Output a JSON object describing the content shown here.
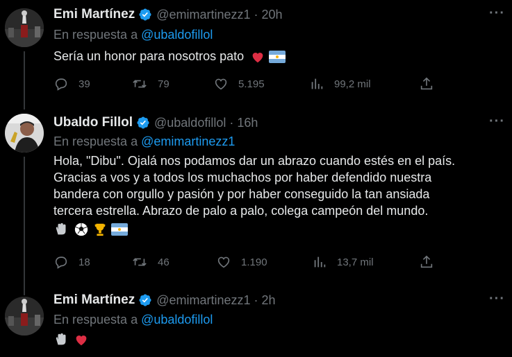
{
  "tweets": [
    {
      "name": "Emi Martínez",
      "handle": "@emimartinezz1",
      "time": "20h",
      "reply_prefix": "En respuesta a",
      "reply_mention": "@ubaldofillol",
      "text": "Sería un honor para nosotros pato",
      "emojis": [
        "red-heart",
        "argentina-flag"
      ],
      "replies": "39",
      "retweets": "79",
      "likes": "5.195",
      "views": "99,2 mil"
    },
    {
      "name": "Ubaldo Fillol",
      "handle": "@ubaldofillol",
      "time": "16h",
      "reply_prefix": "En respuesta a",
      "reply_mention": "@emimartinezz1",
      "text_lines": [
        "Hola, \"Dibu\". Ojalá nos podamos dar un abrazo cuando estés en el país.",
        "Gracias a vos y a todos los muchachos por haber defendido nuestra",
        "bandera con orgullo y pasión y por haber conseguido la tan ansiada",
        "tercera estrella. Abrazo de palo a palo, colega campeón del mundo."
      ],
      "emojis": [
        "gloves",
        "soccer-ball",
        "trophy",
        "argentina-flag"
      ],
      "replies": "18",
      "retweets": "46",
      "likes": "1.190",
      "views": "13,7 mil"
    },
    {
      "name": "Emi Martínez",
      "handle": "@emimartinezz1",
      "time": "2h",
      "reply_prefix": "En respuesta a",
      "reply_mention": "@ubaldofillol",
      "emojis": [
        "gloves",
        "red-heart"
      ]
    }
  ],
  "separator": "·",
  "colors": {
    "background": "#000000",
    "text": "#e7e9ea",
    "muted": "#71767b",
    "link": "#1d9bf0",
    "verified": "#1d9bf0"
  }
}
